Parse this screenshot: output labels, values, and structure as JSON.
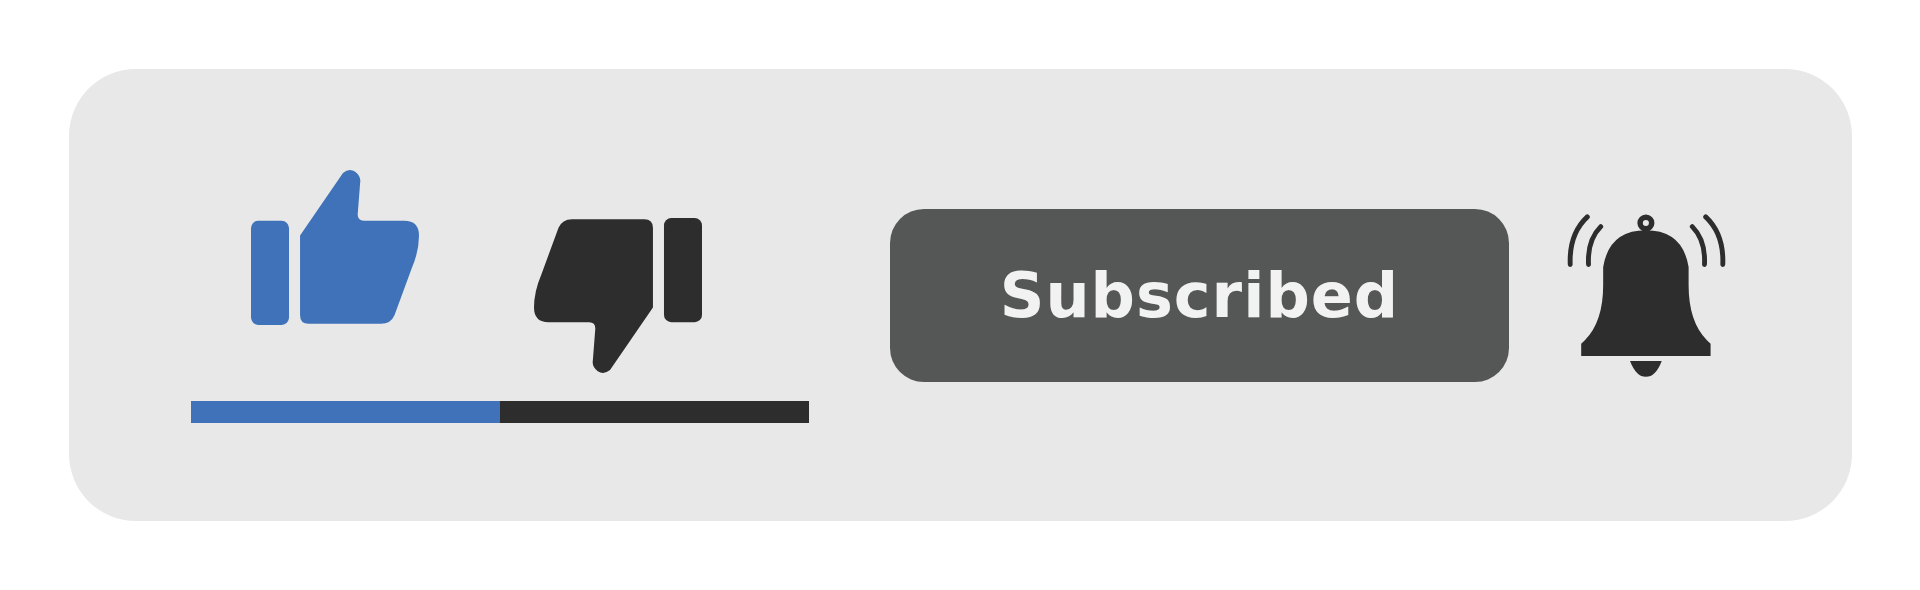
{
  "like": {
    "selected": true
  },
  "dislike": {
    "selected": false
  },
  "ratio_bar": {
    "level": 0.5
  },
  "subscribe_button": {
    "label": "Subscribed"
  },
  "notifications": {
    "on": true
  }
}
